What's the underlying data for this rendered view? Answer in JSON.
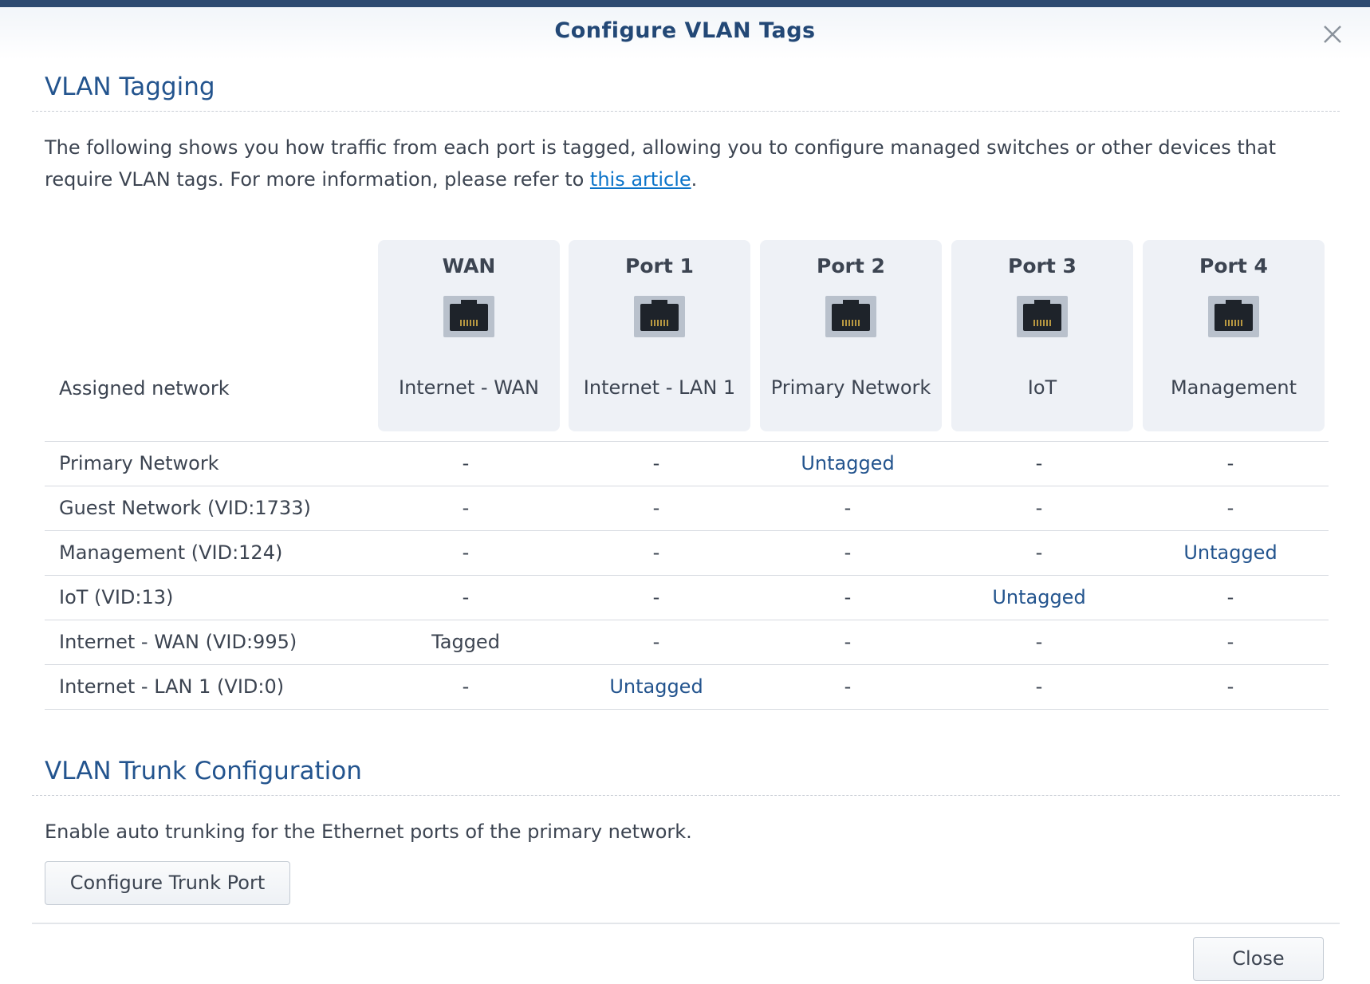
{
  "dialog": {
    "title": "Configure VLAN Tags",
    "close_icon": "close-icon"
  },
  "tagging": {
    "section_title": "VLAN Tagging",
    "description_prefix": "The following shows you how traffic from each port is tagged, allowing you to configure managed switches or other devices that require VLAN tags. For more information, please refer to ",
    "link_text": "this article",
    "description_suffix": ".",
    "assigned_label": "Assigned network",
    "ports": [
      {
        "name": "WAN",
        "network": "Internet - WAN",
        "icon": "ethernet-port-icon"
      },
      {
        "name": "Port 1",
        "network": "Internet - LAN 1",
        "icon": "ethernet-port-icon"
      },
      {
        "name": "Port 2",
        "network": "Primary Network",
        "icon": "ethernet-port-icon"
      },
      {
        "name": "Port 3",
        "network": "IoT",
        "icon": "ethernet-port-icon"
      },
      {
        "name": "Port 4",
        "network": "Management",
        "icon": "ethernet-port-icon"
      }
    ],
    "rows": [
      {
        "network": "Primary Network",
        "cells": [
          "-",
          "-",
          "Untagged",
          "-",
          "-"
        ]
      },
      {
        "network": "Guest Network (VID:1733)",
        "cells": [
          "-",
          "-",
          "-",
          "-",
          "-"
        ]
      },
      {
        "network": "Management (VID:124)",
        "cells": [
          "-",
          "-",
          "-",
          "-",
          "Untagged"
        ]
      },
      {
        "network": "IoT (VID:13)",
        "cells": [
          "-",
          "-",
          "-",
          "Untagged",
          "-"
        ]
      },
      {
        "network": "Internet - WAN (VID:995)",
        "cells": [
          "Tagged",
          "-",
          "-",
          "-",
          "-"
        ]
      },
      {
        "network": "Internet - LAN 1 (VID:0)",
        "cells": [
          "-",
          "Untagged",
          "-",
          "-",
          "-"
        ]
      }
    ]
  },
  "trunk": {
    "section_title": "VLAN Trunk Configuration",
    "description": "Enable auto trunking for the Ethernet ports of the primary network.",
    "button_label": "Configure Trunk Port"
  },
  "footer": {
    "close_label": "Close"
  },
  "colors": {
    "accent": "#23548e",
    "link": "#0a73c9",
    "top_border": "#2d4a70"
  }
}
